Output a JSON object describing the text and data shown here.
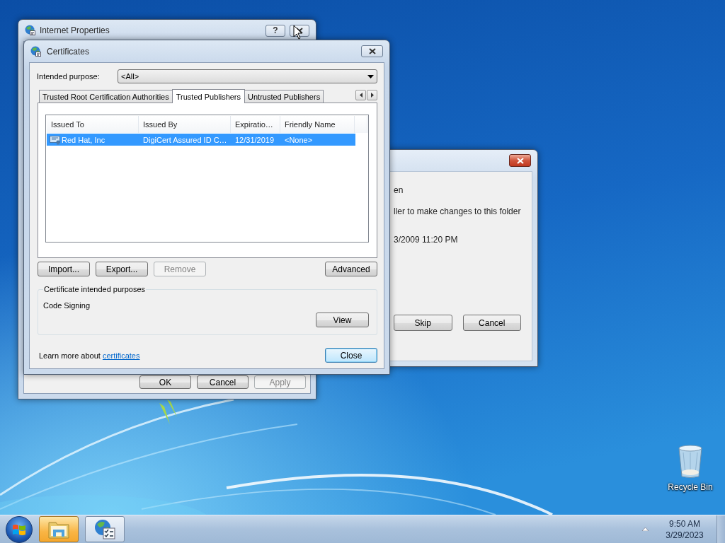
{
  "desktop": {
    "icons": [
      {
        "label": "Recycle Bin"
      }
    ]
  },
  "copy_dialog": {
    "lines": [
      "en",
      "ller to make changes to this folder",
      "3/2009 11:20 PM"
    ],
    "buttons": [
      {
        "label": "Skip"
      },
      {
        "label": "Cancel"
      }
    ]
  },
  "internet_properties": {
    "title": "Internet Properties",
    "help_button": "?",
    "buttons": [
      {
        "label": "OK",
        "disabled": false
      },
      {
        "label": "Cancel",
        "disabled": false
      },
      {
        "label": "Apply",
        "disabled": true
      }
    ]
  },
  "certificates": {
    "title": "Certificates",
    "purpose_label": "Intended purpose:",
    "purpose_value": "<All>",
    "tabs": [
      {
        "label": "Trusted Root Certification Authorities",
        "selected": false
      },
      {
        "label": "Trusted Publishers",
        "selected": true
      },
      {
        "label": "Untrusted Publishers",
        "selected": false
      }
    ],
    "table": {
      "columns": [
        "Issued To",
        "Issued By",
        "Expiratio…",
        "Friendly Name"
      ],
      "rows": [
        {
          "cells": [
            "Red Hat, Inc",
            "DigiCert Assured ID C…",
            "12/31/2019",
            "<None>"
          ],
          "selected": true
        }
      ]
    },
    "buttons": [
      {
        "label": "Import...",
        "disabled": false
      },
      {
        "label": "Export...",
        "disabled": false
      },
      {
        "label": "Remove",
        "disabled": true
      },
      {
        "label": "Advanced",
        "disabled": false
      }
    ],
    "purposes": {
      "title": "Certificate intended purposes",
      "text": "Code Signing",
      "button": "View"
    },
    "footer": {
      "text": "Learn more about",
      "link": "certificates",
      "button": {
        "label": "Close",
        "default": true
      }
    }
  },
  "taskbar": {
    "apps": [
      {
        "kind": "explorer",
        "active": true
      },
      {
        "kind": "internet-options",
        "active": false
      }
    ],
    "time": "9:50 AM",
    "date": "3/29/2023"
  }
}
